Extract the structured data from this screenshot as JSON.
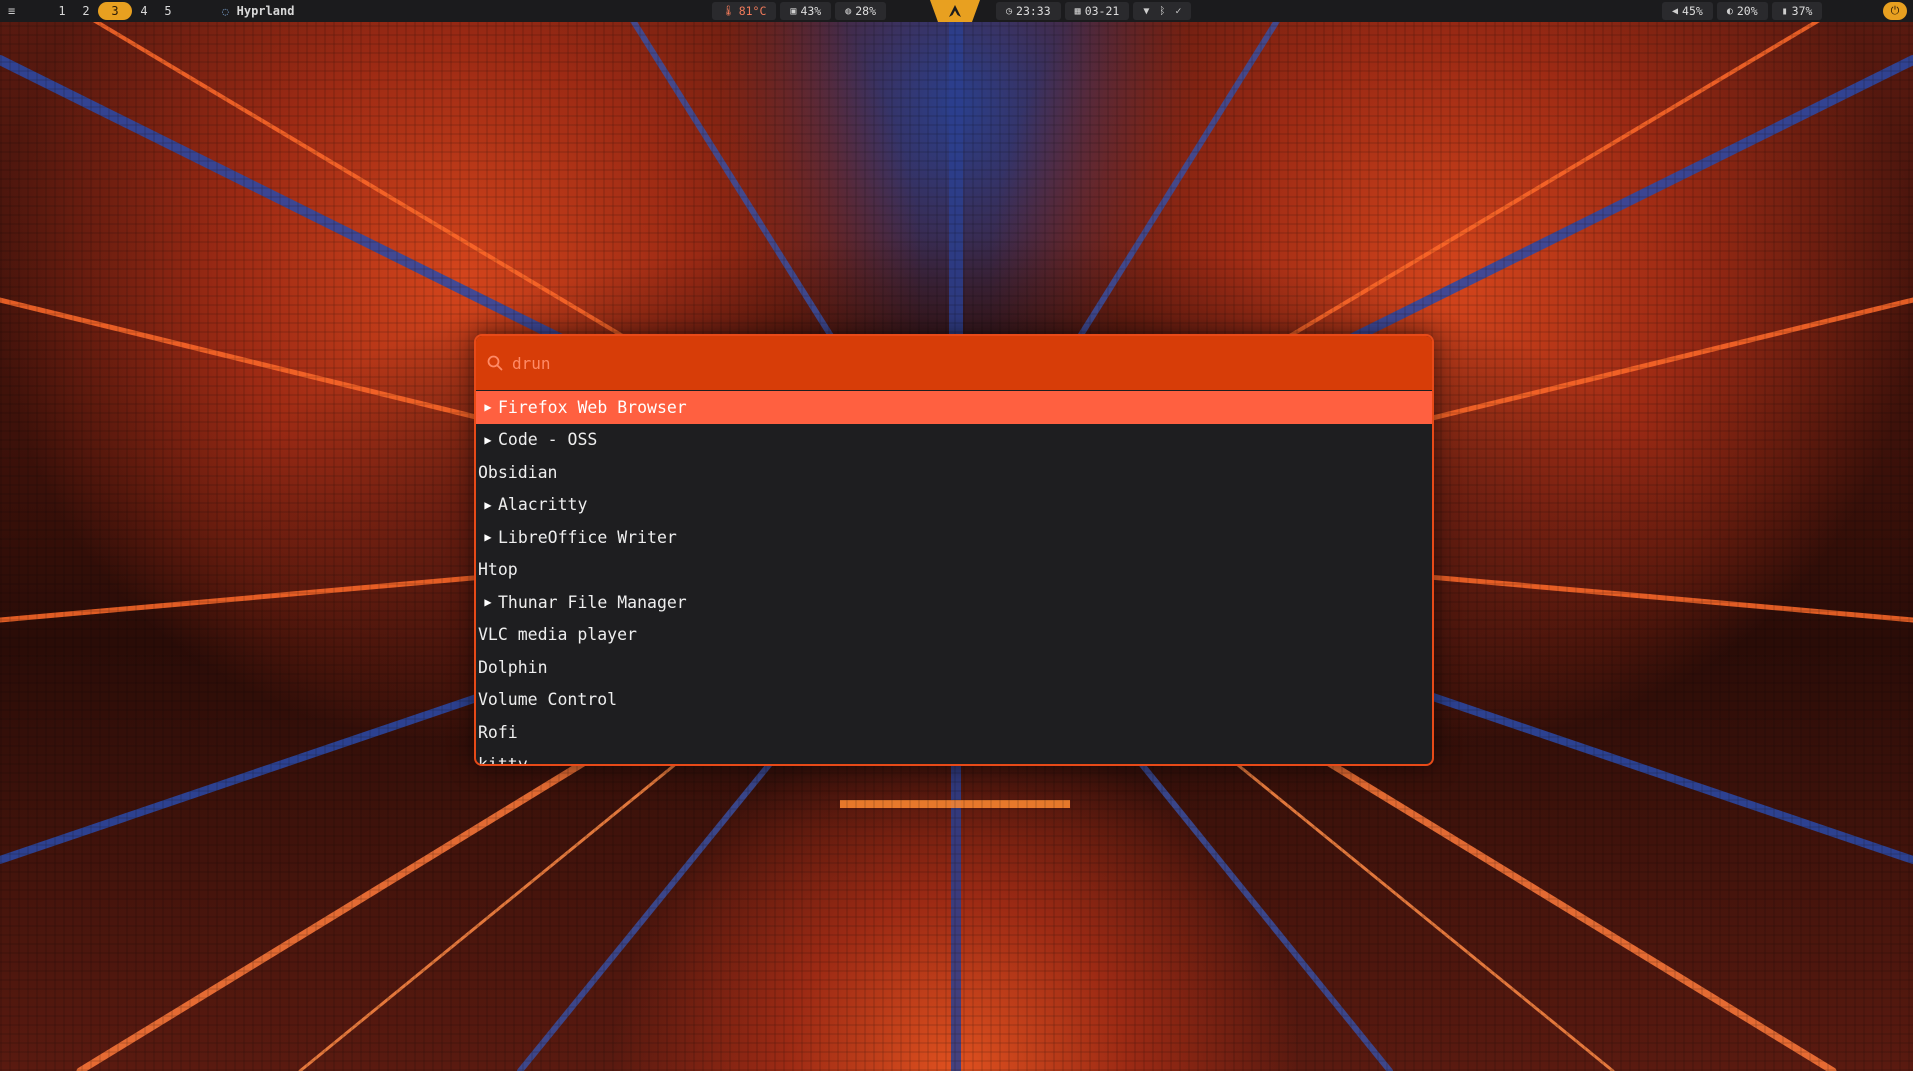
{
  "topbar": {
    "workspaces": [
      "1",
      "2",
      "3",
      "4",
      "5"
    ],
    "active_workspace": "3",
    "window_title": "Hyprland",
    "temperature": "81°C",
    "memory": "43%",
    "cpu": "28%",
    "time": "23:33",
    "date": "03-21",
    "volume": "45%",
    "brightness": "20%",
    "battery": "37%"
  },
  "launcher": {
    "mode_placeholder": "drun",
    "items": [
      {
        "label": "Firefox Web Browser",
        "has_submenu": true,
        "selected": true
      },
      {
        "label": "Code - OSS",
        "has_submenu": true,
        "selected": false
      },
      {
        "label": "Obsidian",
        "has_submenu": false,
        "selected": false
      },
      {
        "label": "Alacritty",
        "has_submenu": true,
        "selected": false
      },
      {
        "label": "LibreOffice Writer",
        "has_submenu": true,
        "selected": false
      },
      {
        "label": "Htop",
        "has_submenu": false,
        "selected": false
      },
      {
        "label": "Thunar File Manager",
        "has_submenu": true,
        "selected": false
      },
      {
        "label": "VLC media player",
        "has_submenu": false,
        "selected": false
      },
      {
        "label": "Dolphin",
        "has_submenu": false,
        "selected": false
      },
      {
        "label": "Volume Control",
        "has_submenu": false,
        "selected": false
      },
      {
        "label": "Rofi",
        "has_submenu": false,
        "selected": false
      },
      {
        "label": "kitty",
        "has_submenu": false,
        "selected": false
      }
    ]
  },
  "colors": {
    "accent": "#e84a18",
    "search_bg": "#d73d08",
    "selected_bg": "#ff6040",
    "list_bg": "#1e1e20",
    "workspace_active": "#e8a020"
  }
}
